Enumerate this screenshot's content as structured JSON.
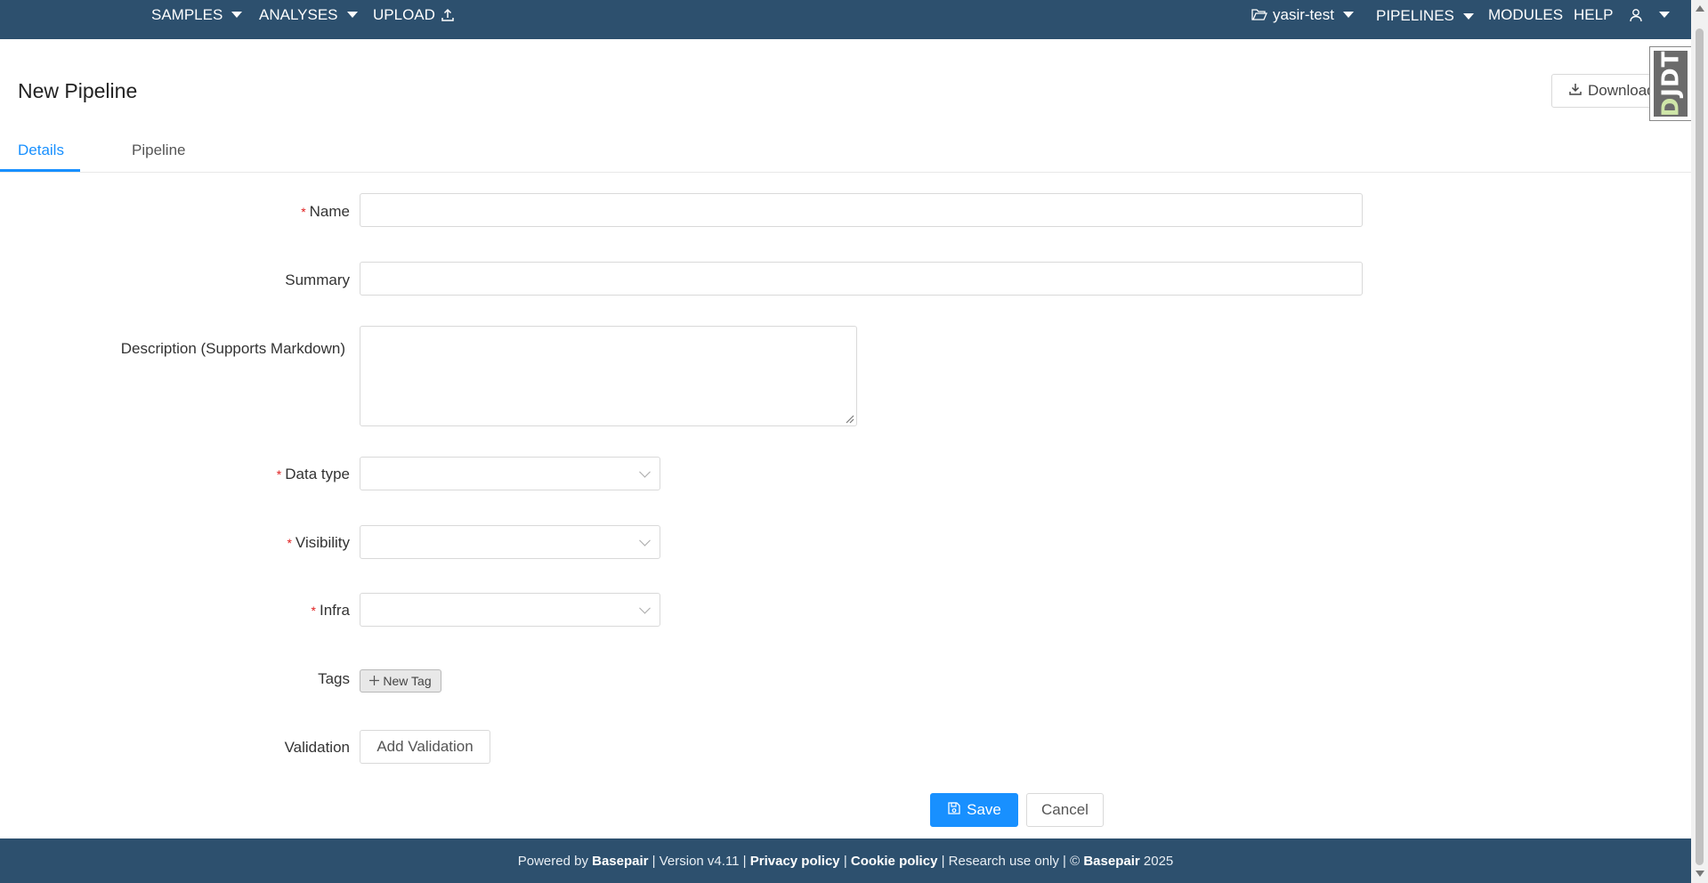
{
  "nav": {
    "samples": "SAMPLES",
    "analyses": "ANALYSES",
    "upload": "UPLOAD",
    "project": "yasir-test",
    "pipelines": "PIPELINES",
    "modules": "MODULES",
    "help": "HELP"
  },
  "header": {
    "title": "New Pipeline",
    "download_label": "Download"
  },
  "djdt": {
    "label": "DJDT"
  },
  "tabs": [
    "Details",
    "Pipeline"
  ],
  "form": {
    "name_label": "Name",
    "summary_label": "Summary",
    "description_label": "Description (Supports Markdown)",
    "data_type_label": "Data type",
    "visibility_label": "Visibility",
    "infra_label": "Infra",
    "tags_label": "Tags",
    "new_tag_label": "New Tag",
    "validation_label": "Validation",
    "add_validation_label": "Add Validation",
    "save_label": "Save",
    "cancel_label": "Cancel",
    "name_value": "",
    "summary_value": "",
    "description_value": ""
  },
  "footer": {
    "powered_by": "Powered by ",
    "brand": "Basepair",
    "version": " | Version v4.11 | ",
    "privacy": "Privacy policy",
    "sep1": " | ",
    "cookie": "Cookie policy",
    "rest": " | Research use only | © ",
    "brand2": "Basepair",
    "year": " 2025"
  },
  "colors": {
    "nav_bg": "#2d506e",
    "accent": "#1890ff",
    "required": "#e02020"
  }
}
